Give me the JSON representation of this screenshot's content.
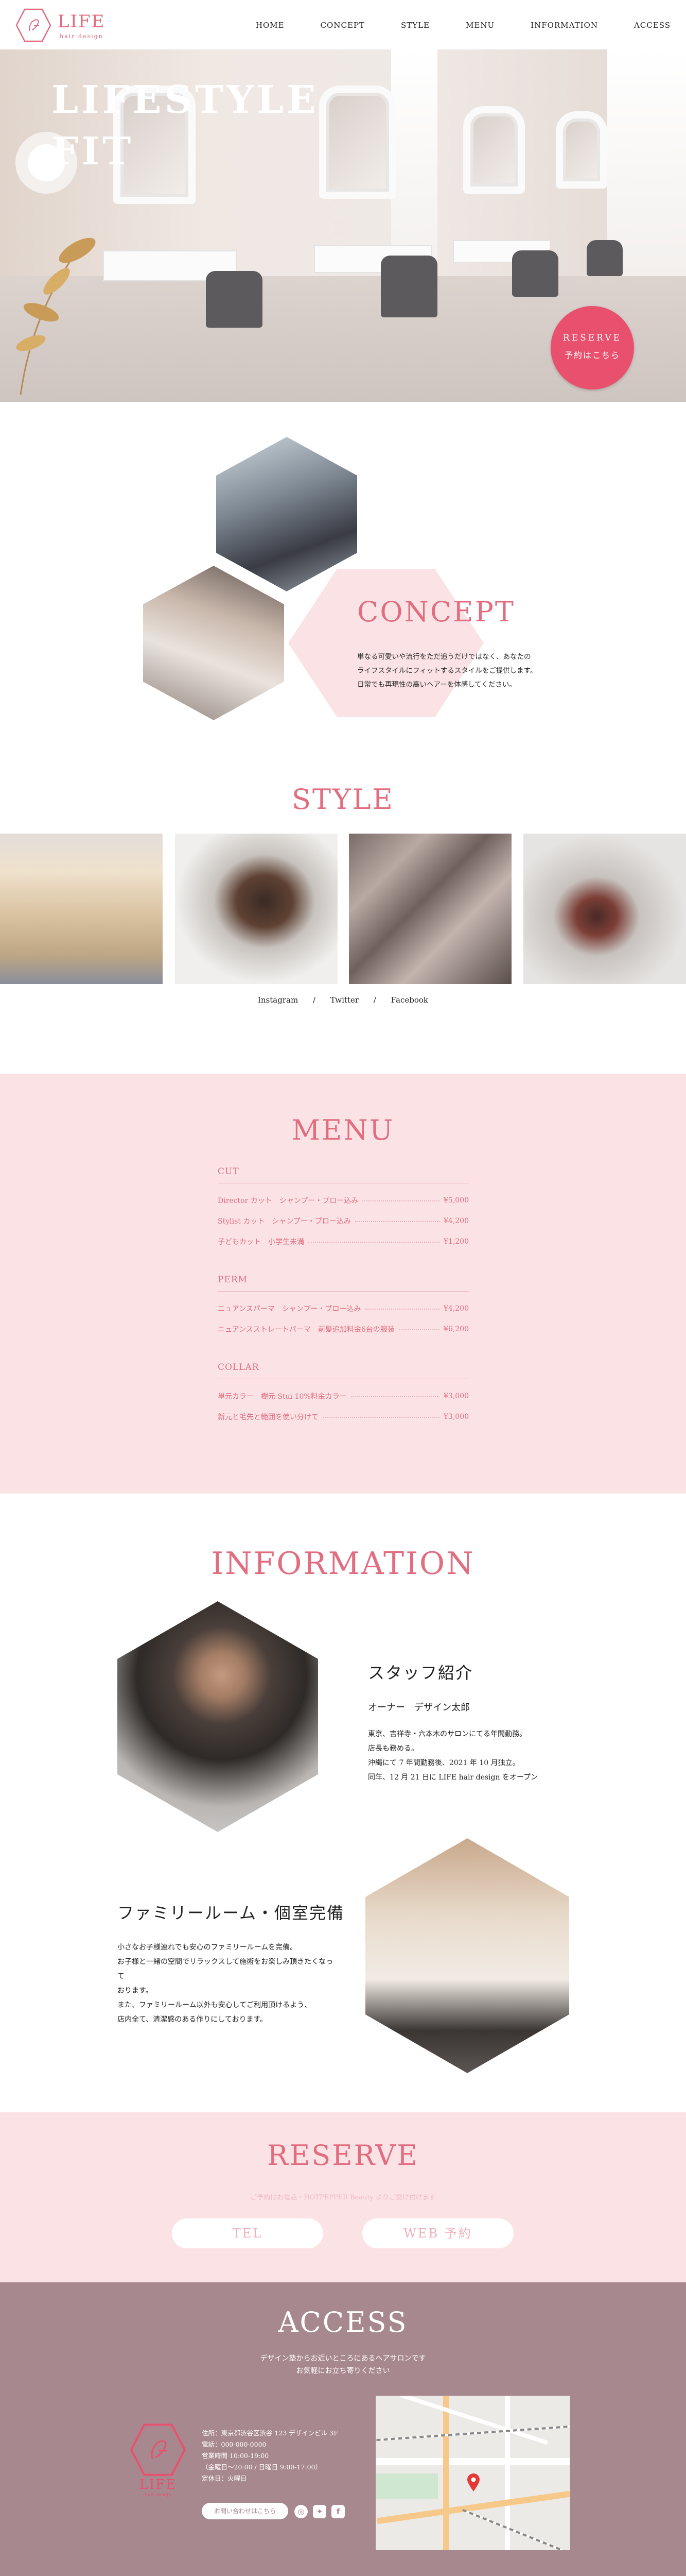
{
  "brand": {
    "name": "LIFE",
    "subtitle": "hair design",
    "color": "#e26d80"
  },
  "nav": [
    "HOME",
    "CONCEPT",
    "STYLE",
    "MENU",
    "INFORMATION",
    "ACCESS"
  ],
  "hero": {
    "title_line1": "LIFESTYLE",
    "title_line2": "FIT",
    "reserve_badge": {
      "line1": "RESERVE",
      "line2": "予約はこちら",
      "color": "#e8506e"
    }
  },
  "concept": {
    "title": "CONCEPT",
    "text": [
      "単なる可愛いや流行をただ追うだけではなく、あなたの",
      "ライフスタイルにフィットするスタイルをご提供します。",
      "日常でも再現性の高いヘアーを体感してください。"
    ]
  },
  "style": {
    "title": "STYLE",
    "links": [
      "Instagram",
      "Twitter",
      "Facebook"
    ],
    "separator": "/"
  },
  "menu": {
    "title": "MENU",
    "categories": [
      {
        "name": "CUT",
        "items": [
          {
            "name": "Director カット　シャンプー・ブロー込み",
            "price": "¥5,000"
          },
          {
            "name": "Stylist カット　シャンプー・ブロー込み",
            "price": "¥4,200"
          },
          {
            "name": "子どもカット　小学生未満",
            "price": "¥1,200"
          }
        ]
      },
      {
        "name": "PERM",
        "items": [
          {
            "name": "ニュアンスパーマ　シャンプー・ブロー込み",
            "price": "¥4,200"
          },
          {
            "name": "ニュアンスストレートパーマ　前髪追加料金6台の服装",
            "price": "¥6,200"
          }
        ]
      },
      {
        "name": "COLLAR",
        "items": [
          {
            "name": "単元カラー　樹元 Stui 10%料金カラー",
            "price": "¥3,000"
          },
          {
            "name": "新元と毛先と範囲を使い分けて",
            "price": "¥3,000"
          }
        ]
      }
    ]
  },
  "information": {
    "title": "INFORMATION",
    "staff": {
      "heading": "スタッフ紹介",
      "role": "オーナー　デザイン太郎",
      "text": [
        "東京、吉祥寺・六本木のサロンにてる年間勤務。",
        "店長も務める。",
        "沖縄にて 7 年間勤務後、2021 年 10 月独立。",
        "同年、12 月 21 日に LIFE hair design をオープン"
      ]
    },
    "room": {
      "heading": "ファミリールーム・個室完備",
      "text": [
        "小さなお子様連れでも安心のファミリールームを完備。",
        "お子様と一緒の空間でリラックスして施術をお楽しみ頂きたくなって",
        "おります。",
        "また、ファミリールーム以外も安心してご利用頂けるよう、",
        "店内全て、清潔感のある作りにしております。"
      ]
    }
  },
  "reserve": {
    "title": "RESERVE",
    "note": "ご予約はお電話・HOTPEPPER Beauty よりご受け付けます",
    "tel_label": "TEL",
    "web_label": "WEB 予約"
  },
  "access": {
    "title": "ACCESS",
    "subtitle": [
      "デザイン塾からお近いところにあるヘアサロンです",
      "お気軽にお立ち寄りください"
    ],
    "address": [
      "住所：東京都渋谷区渋谷 123 デザインビル 3F",
      "電話：000-000-0000",
      "営業時間 10:00-19:00",
      "（金曜日～20:00 / 日曜日 9:00-17:00）",
      "定休日：火曜日"
    ],
    "contact_button": "お問い合わせはこちら",
    "sns": [
      "instagram-icon",
      "twitter-icon",
      "facebook-icon"
    ]
  }
}
